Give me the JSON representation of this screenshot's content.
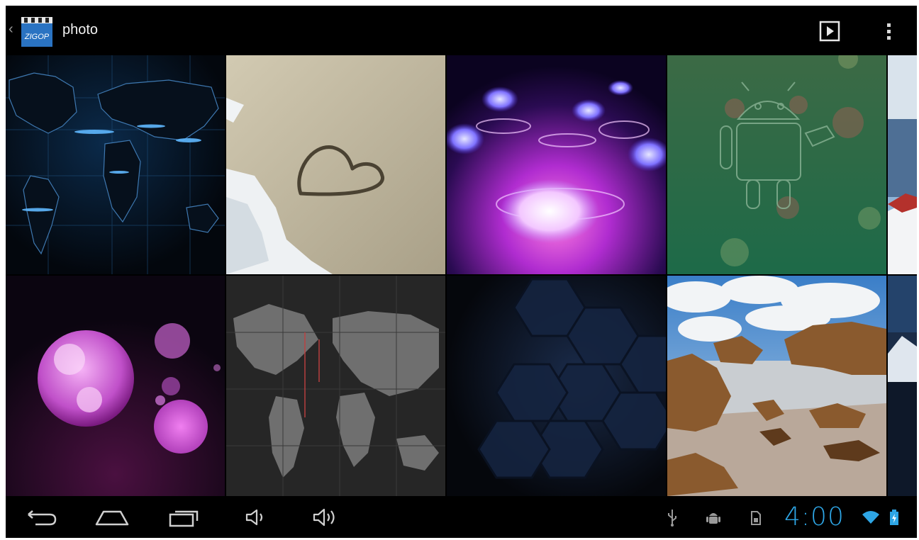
{
  "actionbar": {
    "title": "photo",
    "app_icon_text": "ZIGOP"
  },
  "gallery": {
    "tiles": [
      {
        "id": "world-map-blue"
      },
      {
        "id": "heart-in-sand"
      },
      {
        "id": "purple-lotus-flowers"
      },
      {
        "id": "green-android"
      },
      {
        "id": "snowy-mountain-partial"
      },
      {
        "id": "purple-bokeh"
      },
      {
        "id": "gray-world-map"
      },
      {
        "id": "dark-hexagons"
      },
      {
        "id": "rocky-beach"
      },
      {
        "id": "mountain-partial"
      }
    ]
  },
  "statusbar": {
    "time": "4:00"
  },
  "colors": {
    "clock": "#2ea6e6",
    "background": "#000000",
    "battery": "#2ea6e6"
  }
}
